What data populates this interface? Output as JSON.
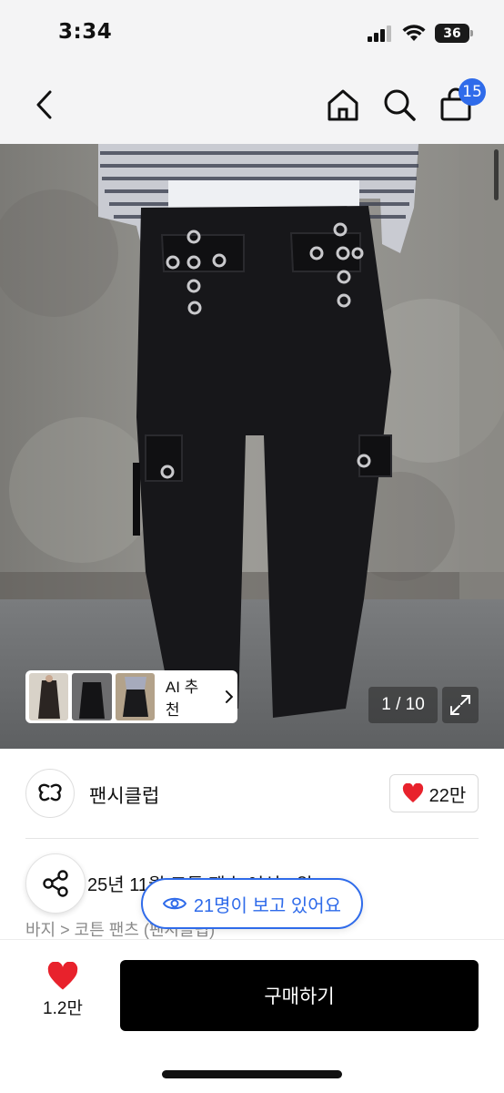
{
  "status_bar": {
    "time": "3:34",
    "battery": "36"
  },
  "nav": {
    "cart_count": "15"
  },
  "gallery": {
    "ai_recommend_label": "AI 추천",
    "counter": "1 / 10"
  },
  "brand": {
    "name": "팬시클럽",
    "likes": "22만"
  },
  "product": {
    "title": "25년 11월 코튼 팬츠 여성 2위 >",
    "breadcrumb": "바지 > 코튼 팬츠 (팬시클럽)"
  },
  "viewers": {
    "text": "21명이 보고 있어요"
  },
  "bottom": {
    "wish_count": "1.2만",
    "buy_label": "구매하기"
  },
  "colors": {
    "accent_blue": "#2f6bea",
    "heart_red": "#e8222c",
    "buy_button": "#000000"
  },
  "icons": [
    "back-chevron-icon",
    "home-icon",
    "search-icon",
    "shopping-bag-icon",
    "chevron-right-icon",
    "expand-icon",
    "heart-icon",
    "share-icon",
    "eye-icon",
    "brand-logo-icon"
  ]
}
